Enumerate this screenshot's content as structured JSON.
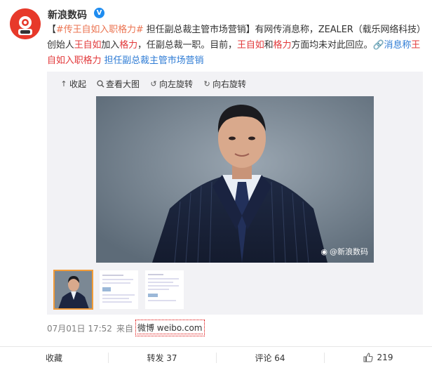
{
  "account": {
    "name": "新浪数码",
    "verified_badge": "V"
  },
  "post": {
    "segments": [
      {
        "text": "【",
        "style": "plain"
      },
      {
        "text": "#传王自如入职格力#",
        "style": "link"
      },
      {
        "text": " 担任副总裁主管市场营销】有网传消息称，ZEALER（载乐网络科技）创始人",
        "style": "plain"
      },
      {
        "text": "王自如",
        "style": "red"
      },
      {
        "text": "加入",
        "style": "plain"
      },
      {
        "text": "格力",
        "style": "red"
      },
      {
        "text": "，任副总裁一职。目前，",
        "style": "plain"
      },
      {
        "text": "王自如",
        "style": "red"
      },
      {
        "text": "和",
        "style": "plain"
      },
      {
        "text": "格力",
        "style": "red"
      },
      {
        "text": "方面均未对此回应。",
        "style": "plain"
      },
      {
        "text": "🔗消息称",
        "style": "blue"
      },
      {
        "text": "王自如入职格力",
        "style": "red"
      },
      {
        "text": " 担任副总裁主管市场营销",
        "style": "blue"
      }
    ]
  },
  "media_toolbar": {
    "collapse": "收起",
    "view_large": "查看大图",
    "rotate_left": "向左旋转",
    "rotate_right": "向右旋转"
  },
  "photo": {
    "watermark": "@新浪数码"
  },
  "thumbnails": [
    {
      "name": "thumb-1",
      "active": true
    },
    {
      "name": "thumb-2",
      "active": false
    },
    {
      "name": "thumb-3",
      "active": false
    }
  ],
  "meta": {
    "time": "07月01日 17:52",
    "from_label": "来自",
    "source": "微博 weibo.com"
  },
  "actions": {
    "favorite": "收藏",
    "repost": "转发 37",
    "comment": "评论 64",
    "like": "219"
  },
  "colors": {
    "topic_link": "#eb7350",
    "highlight": "#e2383a",
    "link_blue": "#2f7cd5",
    "verified": "#1e8cf0",
    "thumb_active": "#f29b38"
  }
}
